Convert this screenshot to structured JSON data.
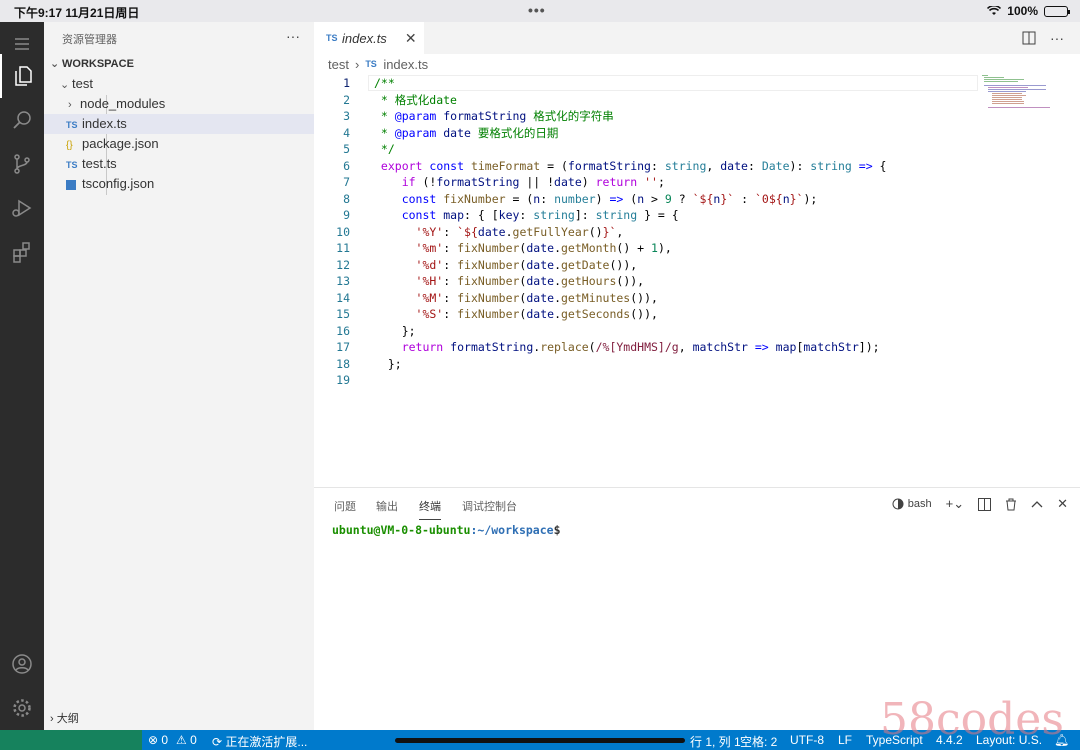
{
  "ios": {
    "time": "下午9:17   11月21日周日",
    "dots": "•••",
    "battery": "100%"
  },
  "sidebar": {
    "title": "资源管理器",
    "more": "···",
    "workspace": "WORKSPACE",
    "folder": "test",
    "items": [
      {
        "label": "node_modules",
        "badge": "›"
      },
      {
        "label": "index.ts",
        "badge": "TS"
      },
      {
        "label": "package.json",
        "badge": "{}"
      },
      {
        "label": "test.ts",
        "badge": "TS"
      },
      {
        "label": "tsconfig.json",
        "badge": ""
      }
    ],
    "outline": "大纲"
  },
  "tabs": [
    {
      "badge": "TS",
      "label": "index.ts",
      "close": "✕"
    }
  ],
  "breadcrumb": {
    "folder": "test",
    "sep": "›",
    "badge": "TS",
    "file": "index.ts"
  },
  "line_numbers": [
    "1",
    "2",
    "3",
    "4",
    "5",
    "6",
    "7",
    "8",
    "9",
    "10",
    "11",
    "12",
    "13",
    "14",
    "15",
    "16",
    "17",
    "18",
    "19"
  ],
  "panel": {
    "tabs": [
      "问题",
      "输出",
      "终端",
      "调试控制台"
    ],
    "active_tab": "终端",
    "shell": "bash",
    "prompt_user": "ubuntu@VM-0-8-ubuntu",
    "prompt_path": ":~/workspace",
    "prompt_end": "$"
  },
  "status": {
    "errors": "⊗ 0",
    "warnings": "⚠ 0",
    "activity": "正在激活扩展...",
    "position": "行 1, 列 1",
    "spaces": "空格: 2",
    "encoding": "UTF-8",
    "eol": "LF",
    "language": "TypeScript",
    "version": "4.4.2",
    "layout": "Layout: U.S."
  },
  "watermark": "58codes",
  "colors": {
    "activitybar": "#2c2c2c",
    "sidebar": "#f3f3f3",
    "statusbar": "#007acc",
    "terminal_user": "#1a8f00",
    "terminal_path": "#2f6fb4"
  }
}
